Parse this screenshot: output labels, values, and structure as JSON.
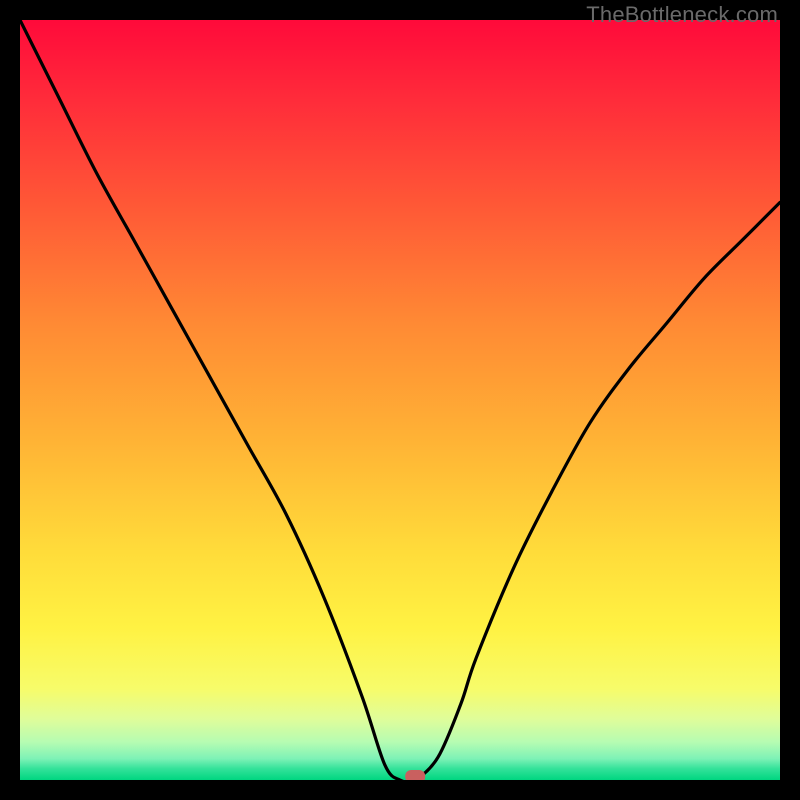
{
  "watermark": "TheBottleneck.com",
  "chart_data": {
    "type": "line",
    "title": "",
    "xlabel": "",
    "ylabel": "",
    "xlim": [
      0,
      100
    ],
    "ylim": [
      0,
      100
    ],
    "x": [
      0,
      5,
      10,
      15,
      20,
      25,
      30,
      35,
      40,
      45,
      48,
      50,
      52,
      55,
      58,
      60,
      65,
      70,
      75,
      80,
      85,
      90,
      95,
      100
    ],
    "series": [
      {
        "name": "bottleneck-curve",
        "values": [
          100,
          90,
          80,
          71,
          62,
          53,
          44,
          35,
          24,
          11,
          2,
          0,
          0,
          3,
          10,
          16,
          28,
          38,
          47,
          54,
          60,
          66,
          71,
          76
        ]
      }
    ],
    "marker": {
      "x": 52,
      "y": 0
    },
    "background": {
      "gradient_top_color": "#ff0a3a",
      "gradient_mid_color": "#ffe940",
      "gradient_bottom_color": "#00d680",
      "green_band_start": 0.95,
      "green_band_end": 1.0
    }
  }
}
